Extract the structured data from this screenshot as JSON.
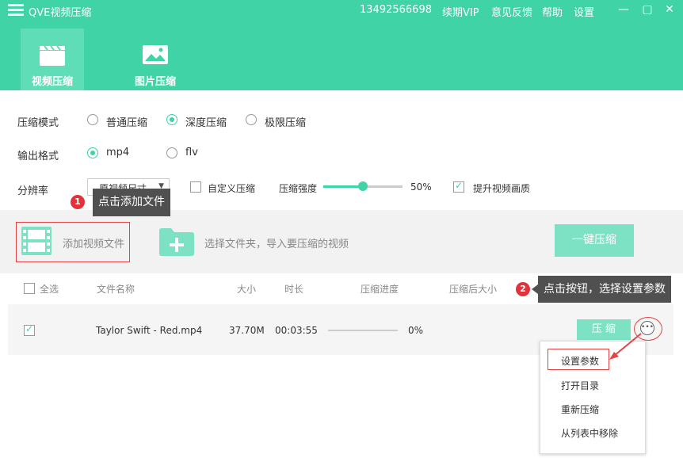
{
  "titlebar": {
    "app_title": "QVE视频压缩",
    "phone": "13492566698",
    "links": {
      "renew_vip": "续期VIP",
      "feedback": "意见反馈",
      "help": "帮助",
      "settings": "设置"
    }
  },
  "nav": {
    "video_tab": "视频压缩",
    "image_tab": "图片压缩"
  },
  "settings": {
    "mode_label": "压缩模式",
    "modes": [
      "普通压缩",
      "深度压缩",
      "极限压缩"
    ],
    "selected_mode": "深度压缩",
    "format_label": "输出格式",
    "formats": [
      "mp4",
      "flv"
    ],
    "selected_format": "mp4",
    "resolution_label": "分辨率",
    "resolution_value": "原视频尺寸",
    "custom_label": "自定义压缩",
    "custom_checked": false,
    "strength_label": "压缩强度",
    "strength_value": "50%",
    "strength_level": 0.5,
    "enhance_label": "提升视频画质",
    "enhance_checked": true
  },
  "toolbar": {
    "add_file": "添加视频文件",
    "add_folder": "选择文件夹，导入要压缩的视频",
    "compress_all": "一键压缩"
  },
  "table": {
    "headers": [
      "全选",
      "文件名称",
      "大小",
      "时长",
      "压缩进度",
      "压缩后大小"
    ],
    "rows": [
      {
        "checked": true,
        "name": "Taylor Swift - Red.mp4",
        "size": "37.70M",
        "duration": "00:03:55",
        "progress": "0%",
        "progress_value": 0,
        "action": "压 缩"
      }
    ]
  },
  "context_menu": {
    "items": [
      "设置参数",
      "打开目录",
      "重新压缩",
      "从列表中移除"
    ]
  },
  "tooltips": {
    "tip1": {
      "number": "1",
      "text": "点击添加文件"
    },
    "tip2": {
      "number": "2",
      "text": "点击按钮，选择设置参数"
    }
  },
  "colors": {
    "accent": "#3fd3a5",
    "accent_light": "#7de2c3",
    "highlight": "#e04444"
  }
}
